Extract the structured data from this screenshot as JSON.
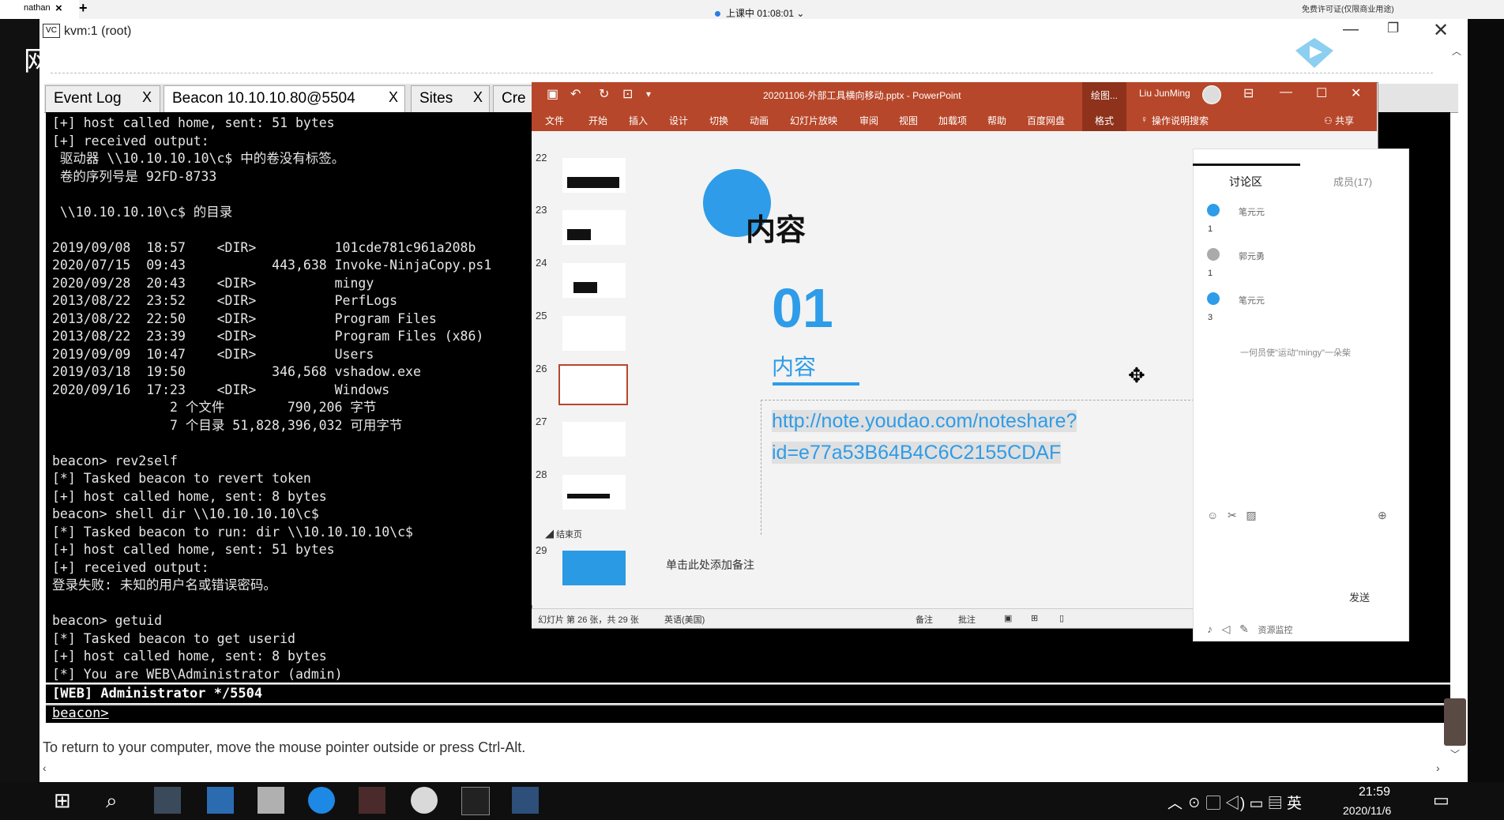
{
  "host_tab": {
    "label": "nathan",
    "close": "×",
    "add": "+"
  },
  "class_status": "上课中 01:08:01 ⌄",
  "top_right_text": "免费许可证(仅限商业用途)",
  "left_edge_char": "网",
  "vm_window": {
    "icon": "VC",
    "title": "kvm:1 (root)",
    "min": "—",
    "max": "❐",
    "close": "✕",
    "hint": "To return to your computer, move the mouse pointer outside or press Ctrl-Alt."
  },
  "cs_tabs": [
    {
      "label": "Event Log",
      "close": "X"
    },
    {
      "label": "Beacon 10.10.10.80@5504",
      "close": "X"
    },
    {
      "label": "Sites",
      "close": "X"
    },
    {
      "label": "Cre"
    }
  ],
  "terminal_lines": [
    "[+] host called home, sent: 51 bytes",
    "[+] received output:",
    " 驱动器 \\\\10.10.10.10\\c$ 中的卷没有标签。",
    " 卷的序列号是 92FD-8733",
    "",
    " \\\\10.10.10.10\\c$ 的目录",
    "",
    "2019/09/08  18:57    <DIR>          101cde781c961a208b",
    "2020/07/15  09:43           443,638 Invoke-NinjaCopy.ps1",
    "2020/09/28  20:43    <DIR>          mingy",
    "2013/08/22  23:52    <DIR>          PerfLogs",
    "2013/08/22  22:50    <DIR>          Program Files",
    "2013/08/22  23:39    <DIR>          Program Files (x86)",
    "2019/09/09  10:47    <DIR>          Users",
    "2019/03/18  19:50           346,568 vshadow.exe",
    "2020/09/16  17:23    <DIR>          Windows",
    "               2 个文件        790,206 字节",
    "               7 个目录 51,828,396,032 可用字节",
    "",
    "beacon> rev2self",
    "[*] Tasked beacon to revert token",
    "[+] host called home, sent: 8 bytes",
    "beacon> shell dir \\\\10.10.10.10\\c$",
    "[*] Tasked beacon to run: dir \\\\10.10.10.10\\c$",
    "[+] host called home, sent: 51 bytes",
    "[+] received output:",
    "登录失败: 未知的用户名或错误密码。",
    "",
    "beacon> getuid",
    "[*] Tasked beacon to get userid",
    "[+] host called home, sent: 8 bytes",
    "[*] You are WEB\\Administrator (admin)"
  ],
  "status_bar": "[WEB] Administrator */5504",
  "prompt": "beacon>",
  "ppt": {
    "title": "20201106-外部工具横向移动.pptx  -  PowerPoint",
    "draw_btn": "绘图...",
    "format_tab": "格式",
    "user": "Liu JunMing",
    "menu": [
      "文件",
      "开始",
      "插入",
      "设计",
      "切换",
      "动画",
      "幻灯片放映",
      "审阅",
      "视图",
      "加载项",
      "帮助",
      "百度网盘"
    ],
    "tell_me": "操作说明搜索",
    "share": "共享",
    "slide_numbers": [
      "22",
      "23",
      "24",
      "25",
      "26",
      "27",
      "28",
      "29"
    ],
    "end_section": "结束页",
    "slide": {
      "title": "内容",
      "number": "01",
      "subtitle": "内容",
      "link": "http://note.youdao.com/noteshare?id=e77a53B64B4C6C2155CDAF"
    },
    "notes_placeholder": "单击此处添加备注",
    "status": {
      "slide_count": "幻灯片 第 26 张，共 29 张",
      "language": "英语(美国)",
      "notes": "备注",
      "comments": "批注"
    }
  },
  "discussion": {
    "tab": "讨论区",
    "members": "成员(17)",
    "entries": [
      {
        "name": "笔元元",
        "value": "1"
      },
      {
        "name": "郭元勇",
        "value": "1"
      },
      {
        "name": "笔元元",
        "value": "3"
      }
    ],
    "message": "一何员使\"运动\"mingy\"一朵柴",
    "send": "发送",
    "bottom": "资源监控"
  },
  "taskbar": {
    "time": "21:59",
    "date": "2020/11/6",
    "ime": "英"
  }
}
